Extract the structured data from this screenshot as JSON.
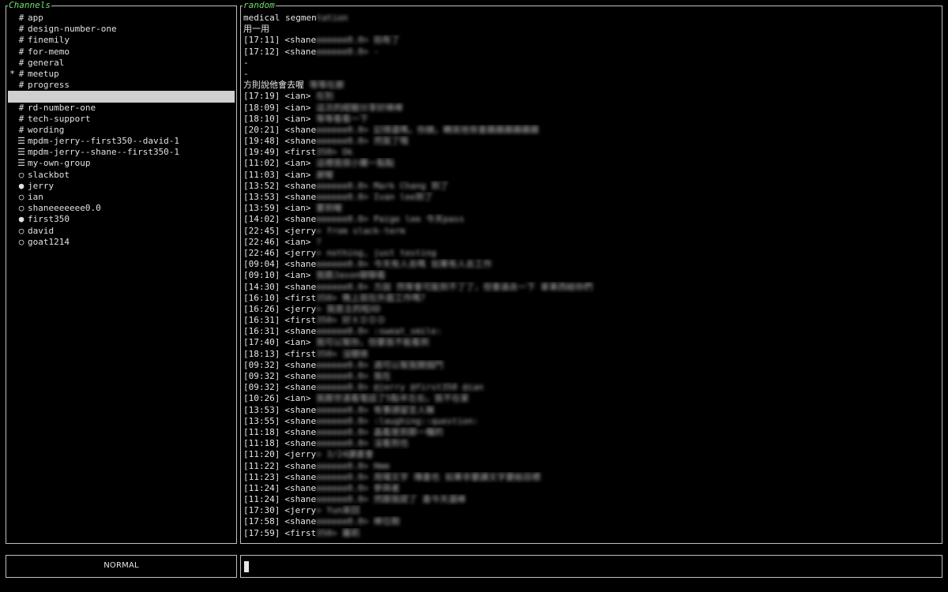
{
  "channels_panel": {
    "title": "Channels",
    "items": [
      {
        "marker": "",
        "icon": "#",
        "label": "app",
        "selected": false
      },
      {
        "marker": "",
        "icon": "#",
        "label": "design-number-one",
        "selected": false
      },
      {
        "marker": "",
        "icon": "#",
        "label": "finemily",
        "selected": false
      },
      {
        "marker": "",
        "icon": "#",
        "label": "for-memo",
        "selected": false
      },
      {
        "marker": "",
        "icon": "#",
        "label": "general",
        "selected": false
      },
      {
        "marker": "*",
        "icon": "#",
        "label": "meetup",
        "selected": false
      },
      {
        "marker": "",
        "icon": "#",
        "label": "progress",
        "selected": false
      },
      {
        "marker": "",
        "icon": "",
        "label": "",
        "selected": true
      },
      {
        "marker": "",
        "icon": "#",
        "label": "rd-number-one",
        "selected": false
      },
      {
        "marker": "",
        "icon": "#",
        "label": "tech-support",
        "selected": false
      },
      {
        "marker": "",
        "icon": "#",
        "label": "wording",
        "selected": false
      },
      {
        "marker": "",
        "icon": "☰",
        "label": "mpdm-jerry--first350--david-1",
        "selected": false
      },
      {
        "marker": "",
        "icon": "☰",
        "label": "mpdm-jerry--shane--first350-1",
        "selected": false
      },
      {
        "marker": "",
        "icon": "☰",
        "label": "my-own-group",
        "selected": false
      },
      {
        "marker": "",
        "icon": "○",
        "label": "slackbot",
        "selected": false
      },
      {
        "marker": "",
        "icon": "●",
        "label": "jerry",
        "selected": false
      },
      {
        "marker": "",
        "icon": "○",
        "label": "ian",
        "selected": false
      },
      {
        "marker": "",
        "icon": "○",
        "label": "shaneeeeeee0.0",
        "selected": false
      },
      {
        "marker": "",
        "icon": "●",
        "label": "first350",
        "selected": false
      },
      {
        "marker": "",
        "icon": "○",
        "label": "david",
        "selected": false
      },
      {
        "marker": "",
        "icon": "○",
        "label": "goat1214",
        "selected": false
      }
    ]
  },
  "messages_panel": {
    "title": "random",
    "lines": [
      {
        "ts": "",
        "user": "",
        "clear": "medical segmen",
        "blur": "tation"
      },
      {
        "ts": "",
        "user": "",
        "clear": "用一用",
        "blur": ""
      },
      {
        "ts": "[17:11]",
        "user": "<shane",
        "clear": "",
        "blur": "eeeeee0.0> 拍有了"
      },
      {
        "ts": "[17:12]",
        "user": "<shane",
        "clear": "",
        "blur": "eeeeee0.0> -"
      },
      {
        "ts": "",
        "user": "",
        "clear": "-",
        "blur": ""
      },
      {
        "ts": "",
        "user": "",
        "clear": "-",
        "blur": ""
      },
      {
        "ts": "",
        "user": "",
        "clear": "方則說他會去喔",
        "blur": " 等等在廊"
      },
      {
        "ts": "[17:19]",
        "user": "<ian>",
        "clear": "",
        "blur": " 在別"
      },
      {
        "ts": "[18:09]",
        "user": "<ian>",
        "clear": "",
        "blur": " 這次的經驗分享好棒棒"
      },
      {
        "ts": "[18:10]",
        "user": "<ian>",
        "clear": "",
        "blur": " 等等看看一下"
      },
      {
        "ts": "[20:21]",
        "user": "<shane",
        "clear": "",
        "blur": "eeeeee0.0> 記得還嗎，你摘，轉其他背書蘋蘋蘋蘋蘋蘋"
      },
      {
        "ts": "[19:48]",
        "user": "<shane",
        "clear": "",
        "blur": "eeeeee0.0> 然我了哦"
      },
      {
        "ts": "[19:49]",
        "user": "<first",
        "clear": "",
        "blur": "350> Ok"
      },
      {
        "ts": "[11:02]",
        "user": "<ian>",
        "clear": "",
        "blur": " 這裡我很小蘭一點點"
      },
      {
        "ts": "[11:03]",
        "user": "<ian>",
        "clear": "",
        "blur": " 謝喔"
      },
      {
        "ts": "[13:52]",
        "user": "<shane",
        "clear": "",
        "blur": "eeeeee0.0> Mark Chang 到了"
      },
      {
        "ts": "[13:53]",
        "user": "<shane",
        "clear": "",
        "blur": "eeeeee0.0> Ivan lee到了"
      },
      {
        "ts": "[13:59]",
        "user": "<ian>",
        "clear": "",
        "blur": " 要到喔"
      },
      {
        "ts": "[14:02]",
        "user": "<shane",
        "clear": "",
        "blur": "eeeeee0.0> Paige lee 今天pass"
      },
      {
        "ts": "[22:45]",
        "user": "<jerry",
        "clear": "",
        "blur": "> from slack-term"
      },
      {
        "ts": "[22:46]",
        "user": "<ian>",
        "clear": "",
        "blur": " ?"
      },
      {
        "ts": "[22:46]",
        "user": "<jerry",
        "clear": "",
        "blur": "> nothing, just testing"
      },
      {
        "ts": "[09:04]",
        "user": "<shane",
        "clear": "",
        "blur": "eeeeee0.0> 今天有人去嗎 如果有人去工作"
      },
      {
        "ts": "[09:10]",
        "user": "<ian>",
        "clear": "",
        "blur": " 我跟Jason聊聊看"
      },
      {
        "ts": "[14:30]",
        "user": "<shane",
        "clear": "",
        "blur": "eeeeee0.0> 方說 然等會可能到不了了，但會過去一下 拿東西給你們"
      },
      {
        "ts": "[16:10]",
        "user": "<first",
        "clear": "",
        "blur": "350> 晚上就在外面工作嗎？"
      },
      {
        "ts": "[16:26]",
        "user": "<jerry",
        "clear": "",
        "blur": "> 我是主的啦XD"
      },
      {
        "ts": "[16:31]",
        "user": "<first",
        "clear": "",
        "blur": "350> 好ＸＤＤＤ"
      },
      {
        "ts": "[16:31]",
        "user": "<shane",
        "clear": "",
        "blur": "eeeeee0.0> :sweat_smile:"
      },
      {
        "ts": "[17:40]",
        "user": "<ian>",
        "clear": "",
        "blur": " 我可以幫你，但要我不能看到"
      },
      {
        "ts": "[18:13]",
        "user": "<first",
        "clear": "",
        "blur": "350> 沒關係"
      },
      {
        "ts": "[09:32]",
        "user": "<shane",
        "clear": "",
        "blur": "eeeeee0.0> 週可以幫我開個門"
      },
      {
        "ts": "[09:32]",
        "user": "<shane",
        "clear": "",
        "blur": "eeeeee0.0> 我在"
      },
      {
        "ts": "[09:32]",
        "user": "<shane",
        "clear": "",
        "blur": "eeeeee0.0> @jerry @first350 @ian"
      },
      {
        "ts": "[10:26]",
        "user": "<ian>",
        "clear": "",
        "blur": " 我跟世達看電話了5點半左右，我不在家"
      },
      {
        "ts": "[13:53]",
        "user": "<shane",
        "clear": "",
        "blur": "eeeeee0.0> 有事請留言人嘛"
      },
      {
        "ts": "[13:55]",
        "user": "<shane",
        "clear": "",
        "blur": "eeeeee0.0> :laughing::question:"
      },
      {
        "ts": "[11:18]",
        "user": "<shane",
        "clear": "",
        "blur": "eeeeee0.0> 晶看是到那一種的"
      },
      {
        "ts": "[11:18]",
        "user": "<shane",
        "clear": "",
        "blur": "eeeeee0.0> 沒看到也"
      },
      {
        "ts": "[11:20]",
        "user": "<jerry",
        "clear": "",
        "blur": "> 3/24讀書會"
      },
      {
        "ts": "[11:22]",
        "user": "<shane",
        "clear": "",
        "blur": "eeeeee0.0> Hmm"
      },
      {
        "ts": "[11:23]",
        "user": "<shane",
        "clear": "",
        "blur": "eeeeee0.0> 用場文字 傳書也 如果非要讀文字要給目標"
      },
      {
        "ts": "[11:24]",
        "user": "<shane",
        "clear": "",
        "blur": "eeeeee0.0> 參與者"
      },
      {
        "ts": "[11:24]",
        "user": "<shane",
        "clear": "",
        "blur": "eeeeee0.0> 然跟我提了 喜今天還棒"
      },
      {
        "ts": "[17:30]",
        "user": "<jerry",
        "clear": "",
        "blur": "> Yun來回"
      },
      {
        "ts": "[17:58]",
        "user": "<shane",
        "clear": "",
        "blur": "eeeeee0.0> 棒位剛"
      },
      {
        "ts": "[17:59]",
        "user": "<first",
        "clear": "",
        "blur": "350> 蘿莉"
      }
    ]
  },
  "status_bar": {
    "mode": "NORMAL"
  },
  "input_bar": {
    "value": ""
  },
  "colors": {
    "background": "#000000",
    "border": "#bfbfbf",
    "title_green": "#6ee06e",
    "selection": "#cfcfcf",
    "text": "#e6e6e6"
  }
}
